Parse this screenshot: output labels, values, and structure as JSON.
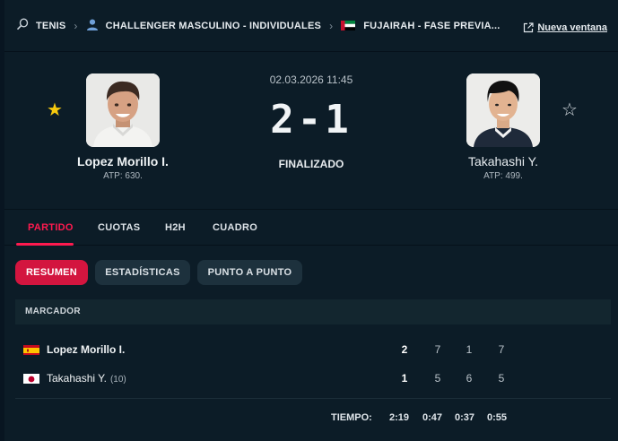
{
  "breadcrumb": {
    "sport": "TENIS",
    "category": "CHALLENGER MASCULINO - INDIVIDUALES",
    "tournament": "FUJAIRAH - FASE PREVIA...",
    "new_window": "Nueva ventana"
  },
  "match": {
    "date": "02.03.2026 11:45",
    "score": "2-1",
    "status": "FINALIZADO"
  },
  "player1": {
    "name": "Lopez Morillo I.",
    "rank": "ATP: 630.",
    "favorite": true
  },
  "player2": {
    "name": "Takahashi Y.",
    "rank": "ATP: 499.",
    "favorite": false
  },
  "tabs": [
    "PARTIDO",
    "CUOTAS",
    "H2H",
    "CUADRO"
  ],
  "subtabs": [
    "RESUMEN",
    "ESTADÍSTICAS",
    "PUNTO A PUNTO"
  ],
  "scoreboard": {
    "title": "MARCADOR",
    "rows": [
      {
        "name": "Lopez Morillo I.",
        "seed": "",
        "sets": "2",
        "games": [
          "7",
          "1",
          "7"
        ]
      },
      {
        "name": "Takahashi Y.",
        "seed": "(10)",
        "sets": "1",
        "games": [
          "5",
          "6",
          "5"
        ]
      }
    ],
    "time_label": "TIEMPO:",
    "times": [
      "2:19",
      "0:47",
      "0:37",
      "0:55"
    ]
  },
  "colors": {
    "accent": "#ff1a4f",
    "star": "#f6c90e",
    "background": "#0c1c27"
  }
}
